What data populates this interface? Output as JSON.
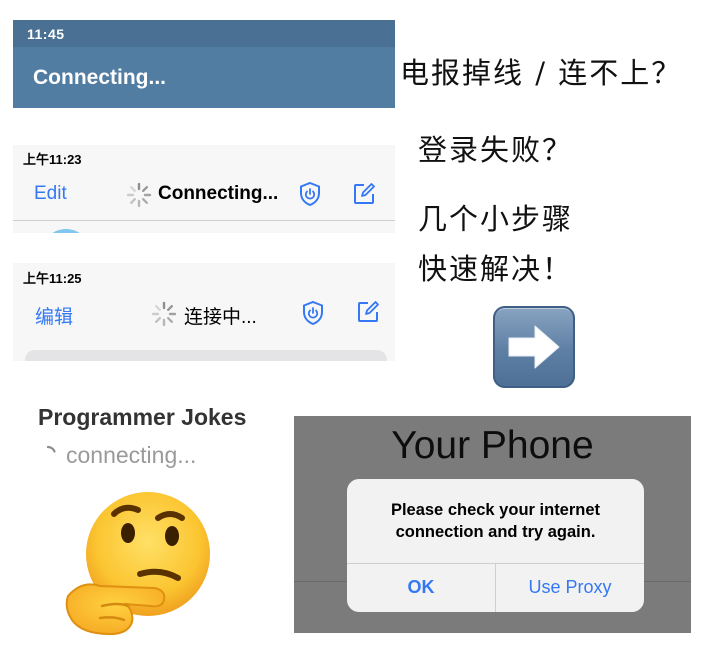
{
  "panel1": {
    "time": "11:45",
    "title": "Connecting..."
  },
  "panel2": {
    "time": "上午11:23",
    "edit": "Edit",
    "title": "Connecting..."
  },
  "panel3": {
    "time": "上午11:25",
    "edit": "编辑",
    "title": "连接中..."
  },
  "caption": {
    "line1": "电报掉线 / 连不上？",
    "line2": "登录失败？",
    "line3": "几个小步骤",
    "line4": "快速解决！"
  },
  "chat": {
    "name": "Programmer Jokes",
    "status": "connecting..."
  },
  "dialog_screen": {
    "title": "Your Phone",
    "message_line1": "Please check your internet",
    "message_line2": "connection and try again.",
    "ok": "OK",
    "proxy": "Use Proxy"
  },
  "colors": {
    "bar_blue": "#527da3",
    "ios_blue": "#3478f6",
    "dialog_bg": "#7b7b7b"
  },
  "icons": [
    "spinner-icon",
    "shield-power-icon",
    "compose-icon",
    "right-arrow-icon",
    "thinking-face-emoji"
  ]
}
